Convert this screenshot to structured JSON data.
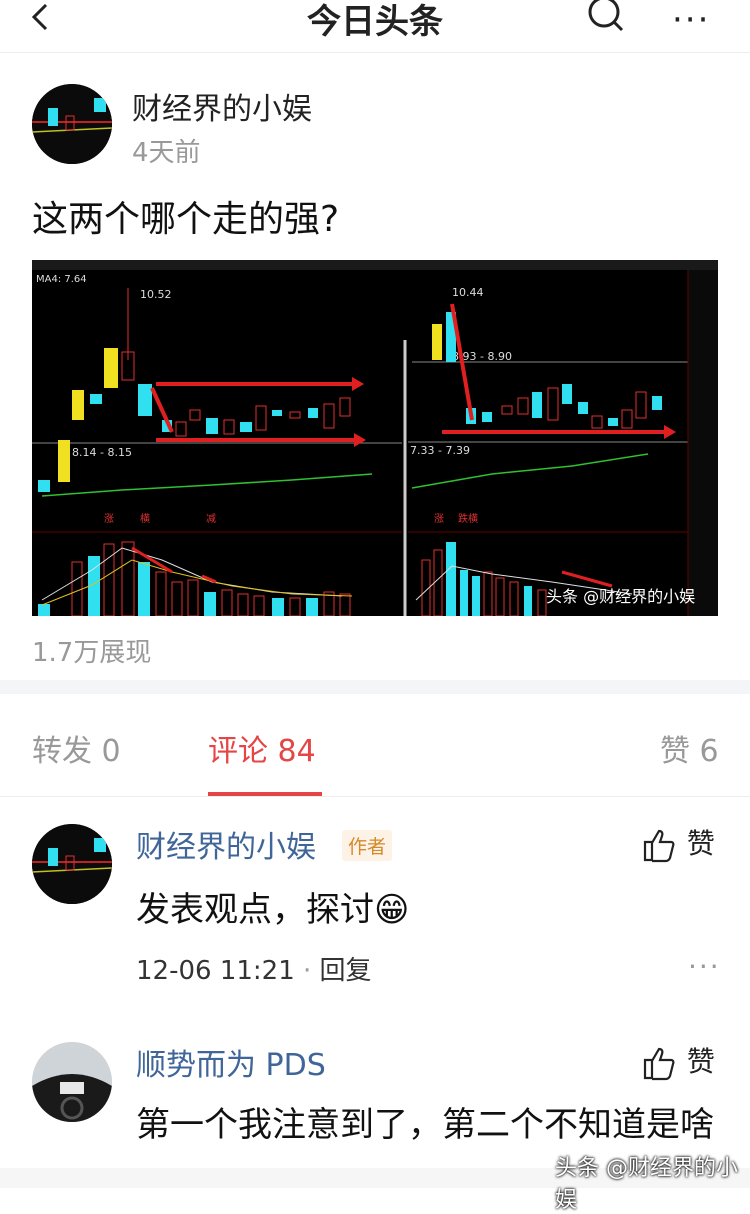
{
  "header": {
    "title": "今日头条"
  },
  "post": {
    "author": "财经界的小娱",
    "time": "4天前",
    "text": "这两个哪个走的强?",
    "views": "1.7万展现",
    "chart": {
      "left": {
        "ma": "MA4: 7.64",
        "high": "10.52",
        "range": "8.14 - 8.15",
        "tags": [
          "涨",
          "横",
          "减"
        ]
      },
      "right": {
        "high": "10.44",
        "range1": "8.93 - 8.90",
        "range2": "7.33 - 7.39",
        "tags": [
          "涨",
          "跌横"
        ]
      },
      "watermark": "头条 @财经界的小娱"
    }
  },
  "tabs": {
    "repost": "转发 0",
    "comments": "评论 84",
    "likes": "赞 6"
  },
  "comments": [
    {
      "name": "财经界的小娱",
      "tag": "作者",
      "text": "发表观点，探讨😁",
      "time": "12-06 11:21",
      "reply": "回复",
      "like": "赞"
    },
    {
      "name": "顺势而为 PDS",
      "text": "第一个我注意到了，第二个不知道是啥",
      "like": "赞"
    }
  ],
  "watermark": "头条 @财经界的小娱",
  "colors": {
    "accent": "#e64545",
    "link": "#406599"
  }
}
